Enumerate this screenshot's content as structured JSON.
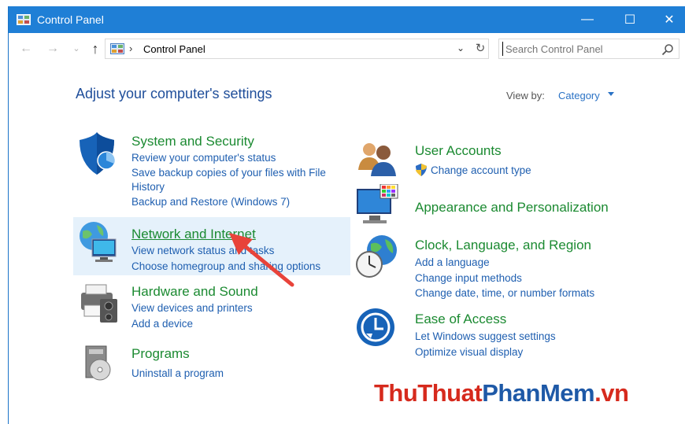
{
  "window": {
    "title": "Control Panel",
    "minimize": "—",
    "maximize": "☐",
    "close": "✕"
  },
  "nav": {
    "back": "←",
    "forward": "→",
    "recent": "⌄",
    "up": "↑"
  },
  "address": {
    "separator": "›",
    "crumb": "Control Panel",
    "dropdown": "⌄",
    "refresh": "↻"
  },
  "search": {
    "placeholder": "Search Control Panel"
  },
  "heading": "Adjust your computer's settings",
  "view_by": {
    "label": "View by:",
    "value": "Category"
  },
  "categories": [
    {
      "title": "System and Security",
      "links": [
        "Review your computer's status",
        "Save backup copies of your files with File",
        "History",
        "Backup and Restore (Windows 7)"
      ]
    },
    {
      "title": "Network and Internet",
      "links": [
        "View network status and tasks",
        "Choose homegroup and sharing options"
      ]
    },
    {
      "title": "Hardware and Sound",
      "links": [
        "View devices and printers",
        "Add a device"
      ]
    },
    {
      "title": "Programs",
      "links": [
        "Uninstall a program"
      ]
    },
    {
      "title": "User Accounts",
      "links": [
        "Change account type"
      ]
    },
    {
      "title": "Appearance and Personalization",
      "links": []
    },
    {
      "title": "Clock, Language, and Region",
      "links": [
        "Add a language",
        "Change input methods",
        "Change date, time, or number formats"
      ]
    },
    {
      "title": "Ease of Access",
      "links": [
        "Let Windows suggest settings",
        "Optimize visual display"
      ]
    }
  ],
  "watermark": {
    "part1": "ThuThuat",
    "part2": "PhanMem",
    "part3": ".vn"
  },
  "colors": {
    "titlebar": "#1f7fd6",
    "category_title": "#1b8a31",
    "link": "#1f5fb0",
    "heading": "#1f4e9a",
    "highlight": "#e5f1fb",
    "arrow": "#e8433a"
  }
}
